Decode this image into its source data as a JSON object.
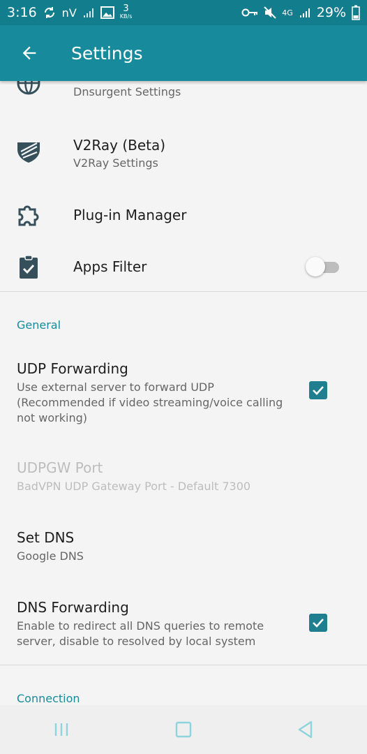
{
  "status": {
    "time": "3:16",
    "carrier": "nV",
    "speed_value": "3",
    "speed_unit": "KB/s",
    "network": "4G",
    "battery": "29%"
  },
  "appbar": {
    "title": "Settings"
  },
  "items": {
    "dnsurgent": {
      "subtitle": "Dnsurgent Settings"
    },
    "v2ray": {
      "title": "V2Ray (Beta)",
      "subtitle": "V2Ray Settings"
    },
    "plugin": {
      "title": "Plug-in Manager"
    },
    "apps_filter": {
      "title": "Apps Filter",
      "enabled": false
    }
  },
  "general": {
    "header": "General",
    "udp_forwarding": {
      "title": "UDP Forwarding",
      "subtitle": "Use external server to forward UDP (Recommended if video streaming/voice calling not working)",
      "checked": true
    },
    "udpgw_port": {
      "title": "UDPGW Port",
      "subtitle": "BadVPN UDP Gateway Port - Default 7300",
      "disabled": true
    },
    "set_dns": {
      "title": "Set DNS",
      "subtitle": "Google DNS"
    },
    "dns_forwarding": {
      "title": "DNS Forwarding",
      "subtitle": "Enable to redirect all DNS queries to remote server, disable to resolved by local system",
      "checked": true
    }
  },
  "connection": {
    "header": "Connection"
  },
  "colors": {
    "status_bar": "#127e8d",
    "app_bar": "#178b9b",
    "accent": "#1f7f8f",
    "icon": "#35505a"
  }
}
